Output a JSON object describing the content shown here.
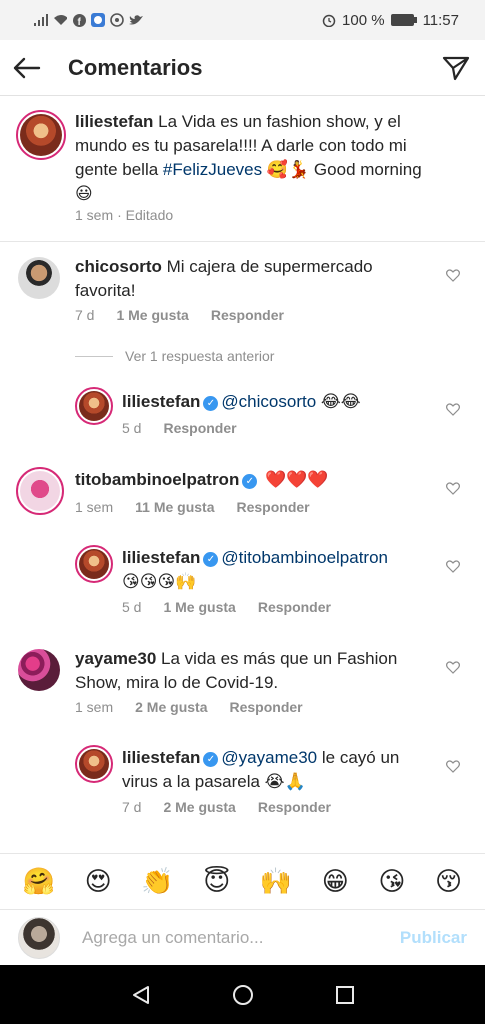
{
  "status_bar": {
    "battery": "100 %",
    "time": "11:57"
  },
  "header": {
    "title": "Comentarios"
  },
  "caption": {
    "username": "liliestefan",
    "text_line1": "La Vida es un fashion show, y el",
    "text_line2": "mundo es tu pasarela!!!! A darle con todo mi",
    "text_line3_a": "gente bella",
    "hashtag": "#FelizJueves",
    "text_line3_b": "🥰💃 Good morning",
    "emoji_line4": "😃",
    "time": "1 sem",
    "edited": "· Editado"
  },
  "comments": [
    {
      "username": "chicosorto",
      "text_line1": "Mi cajera de supermercado",
      "text_line2": "favorita!",
      "time": "7 d",
      "likes": "1 Me gusta",
      "reply": "Responder"
    },
    {
      "username": "liliestefan",
      "mention": "@chicosorto",
      "emoji": "😂😂",
      "time": "5 d",
      "reply": "Responder"
    },
    {
      "username": "titobambinoelpatron",
      "emoji": "❤️❤️❤️",
      "time": "1 sem",
      "likes": "11 Me gusta",
      "reply": "Responder"
    },
    {
      "username": "liliestefan",
      "mention": "@titobambinoelpatron",
      "emoji": "😘😘😘🙌",
      "time": "5 d",
      "likes": "1 Me gusta",
      "reply": "Responder"
    },
    {
      "username": "yayame30",
      "text_line1": "La vida es más que un Fashion",
      "text_line2": "Show, mira lo de Covid-19.",
      "time": "1 sem",
      "likes": "2 Me gusta",
      "reply": "Responder"
    },
    {
      "username": "liliestefan",
      "mention": "@yayame30",
      "text_a": "le cayó un",
      "text_line2": "virus a la pasarela 😭🙏",
      "time": "7 d",
      "likes": "2 Me gusta",
      "reply": "Responder"
    }
  ],
  "view_replies": "Ver 1 respuesta anterior",
  "emoji_bar": [
    "🤗",
    "😍",
    "👏",
    "😇",
    "🙌",
    "😁",
    "😘",
    "😚"
  ],
  "input": {
    "placeholder": "Agrega un comentario...",
    "post": "Publicar"
  },
  "colors": {
    "verified": "#3897f0",
    "hashtag": "#00376b",
    "post_disabled": "#b2dffc",
    "story_ring": "#d62976"
  }
}
